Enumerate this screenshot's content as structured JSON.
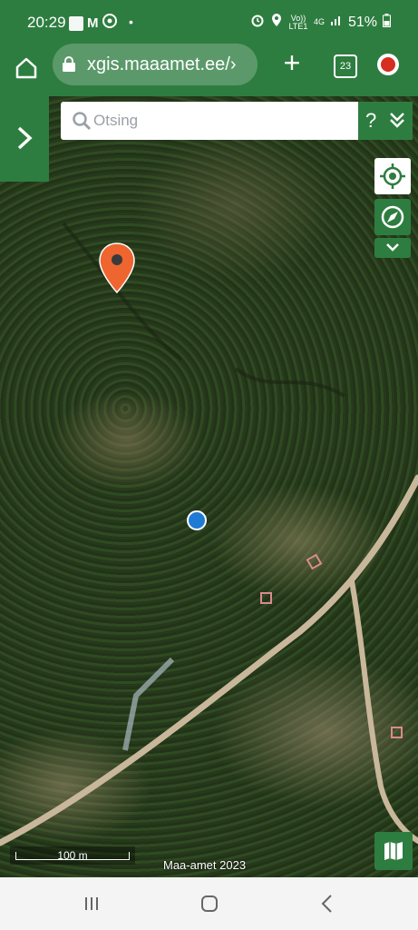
{
  "status_bar": {
    "time": "20:29",
    "dot": "•",
    "volte": "Vo)) LTE1",
    "network": "4G",
    "battery": "51%"
  },
  "browser": {
    "url": "xgis.maaamet.ee/›",
    "plus": "+",
    "tab_count": "23"
  },
  "search": {
    "placeholder": "Otsing"
  },
  "help": {
    "label": "?"
  },
  "map": {
    "scale_label": "100 m",
    "attribution": "Maa-amet 2023"
  },
  "colors": {
    "brand_green": "#2e7d40",
    "pin_orange": "#ee6530",
    "gps_blue": "#1f7ad4"
  }
}
